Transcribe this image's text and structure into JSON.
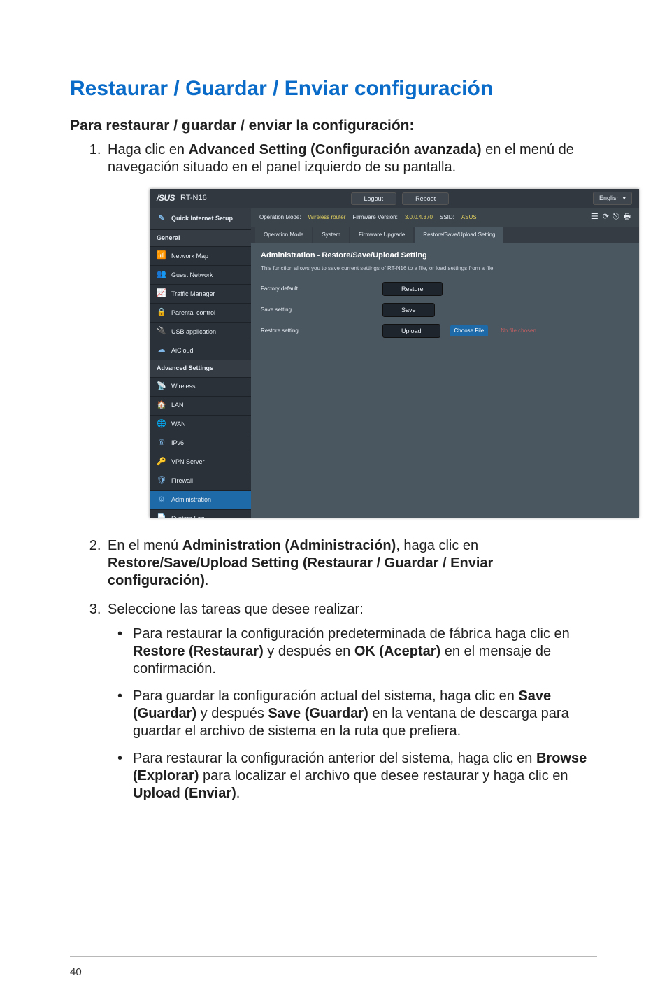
{
  "doc": {
    "title": "Restaurar / Guardar / Enviar configuración",
    "subhead": "Para restaurar / guardar / enviar la configuración:",
    "step1_pre": "Haga clic en ",
    "step1_bold": "Advanced Setting (Configuración avanzada)",
    "step1_post": " en el menú de navegación situado en el panel izquierdo de su pantalla.",
    "step2_pre": "En el menú ",
    "step2_b1": "Administration (Administración)",
    "step2_mid": ", haga clic en ",
    "step2_b2": "Restore/Save/Upload Setting (Restaurar / Guardar / Enviar configuración)",
    "step2_post": ".",
    "step3": "Seleccione las tareas que desee realizar:",
    "bullet1_a": "Para restaurar la configuración predeterminada de fábrica haga clic en ",
    "bullet1_b1": "Restore (Restaurar)",
    "bullet1_mid": " y después en ",
    "bullet1_b2": "OK (Aceptar)",
    "bullet1_post": " en el mensaje de confirmación.",
    "bullet2_a": "Para guardar la configuración actual del sistema, haga clic en ",
    "bullet2_b1": "Save (Guardar)",
    "bullet2_mid": " y después ",
    "bullet2_b2": "Save (Guardar)",
    "bullet2_post": " en la ventana de descarga para guardar el archivo de sistema en la ruta que prefiera.",
    "bullet3_a": "Para restaurar la configuración anterior del sistema, haga clic en ",
    "bullet3_b1": "Browse (Explorar)",
    "bullet3_mid": " para localizar el archivo que desee restaurar y haga clic en ",
    "bullet3_b2": "Upload (Enviar)",
    "bullet3_post": ".",
    "page_number": "40"
  },
  "router": {
    "brand": "/SUS",
    "model": "RT-N16",
    "logout": "Logout",
    "reboot": "Reboot",
    "language": "English",
    "info": {
      "opmode_label": "Operation Mode:",
      "opmode_value": "Wireless router",
      "fw_label": "Firmware Version:",
      "fw_value": "3.0.0.4.370",
      "ssid_label": "SSID:",
      "ssid_value": "ASUS"
    },
    "tabs": [
      "Operation Mode",
      "System",
      "Firmware Upgrade",
      "Restore/Save/Upload Setting"
    ],
    "panel": {
      "title": "Administration - Restore/Save/Upload Setting",
      "desc": "This function allows you to save current settings of RT-N16 to a file, or load settings from a file.",
      "rows": [
        {
          "label": "Factory default",
          "button": "Restore"
        },
        {
          "label": "Save setting",
          "button": "Save"
        },
        {
          "label": "Restore setting",
          "button": "Upload",
          "choose": "Choose File",
          "nofile": "No file chosen"
        }
      ]
    },
    "sidebar": {
      "qis": "Quick Internet Setup",
      "general_header": "General",
      "general": [
        "Network Map",
        "Guest Network",
        "Traffic Manager",
        "Parental control",
        "USB application",
        "AiCloud"
      ],
      "adv_header": "Advanced Settings",
      "advanced": [
        "Wireless",
        "LAN",
        "WAN",
        "IPv6",
        "VPN Server",
        "Firewall",
        "Administration",
        "System Log"
      ]
    }
  },
  "icons": {
    "general": [
      "📶",
      "👥",
      "📈",
      "🔒",
      "🔌",
      "☁"
    ],
    "advanced": [
      "📡",
      "🏠",
      "🌐",
      "⑥",
      "🔑",
      "🛡",
      "⚙",
      "📄"
    ],
    "qis": "✎",
    "chevron": "▾",
    "info_icons": [
      "☰",
      "⟳",
      "⎋",
      "🖶"
    ]
  }
}
